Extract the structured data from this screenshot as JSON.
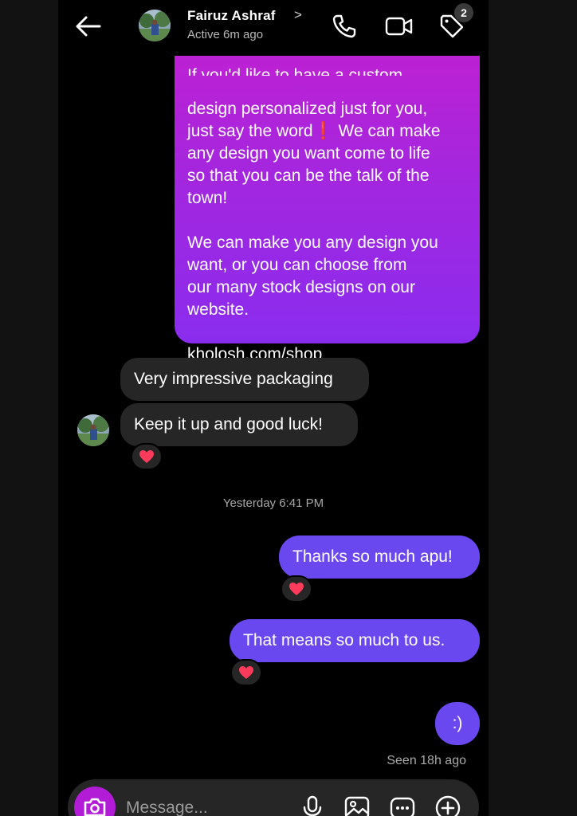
{
  "header": {
    "contact_name": "Fairuz Ashraf",
    "name_chevron": ">",
    "status": "Active 6m ago",
    "badge_count": "2",
    "icons": [
      "back-arrow-icon",
      "phone-icon",
      "video-icon",
      "tag-icon"
    ]
  },
  "messages": {
    "big_partial_line": "If you'd like to have a custom",
    "big_lines": "design personalized just for you,\njust say the word❗ We can make\nany design you want come to life\nso that you can be the talk of the\ntown!\n\nWe can make you any design you\nwant, or you can choose from\nour many stock designs on our\nwebsite.\n\nkholosh.com/shop",
    "in_1": "Very impressive packaging",
    "in_2": "Keep it up and good luck!",
    "timestamp": "Yesterday 6:41 PM",
    "out_1": "Thanks so much apu!",
    "out_2": "That means so much to us.",
    "out_3": ":)",
    "seen": "Seen 18h ago",
    "reaction_emoji": "heart"
  },
  "composer": {
    "placeholder": "Message...",
    "icons": [
      "camera-icon",
      "microphone-icon",
      "gallery-icon",
      "sticker-icon",
      "plus-icon"
    ]
  },
  "colors": {
    "background": "#000000",
    "incoming_bubble": "#262626",
    "outgoing_bubble": "#6a48ef",
    "gradient_top": "#c51fd0",
    "gradient_bottom": "#8a2cee",
    "camera_button": "#b31cd6",
    "heart": "#ff3b5c"
  }
}
